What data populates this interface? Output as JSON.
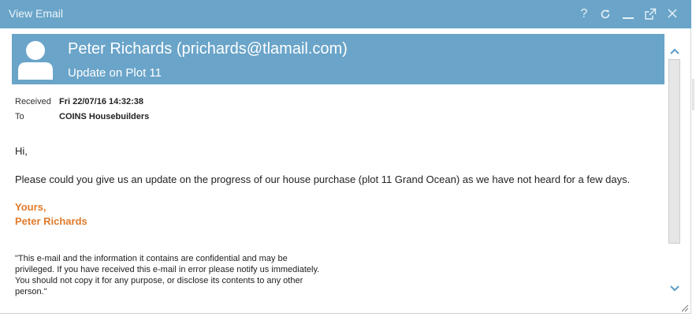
{
  "window": {
    "title": "View Email"
  },
  "title_bar_icons": [
    "help-icon",
    "refresh-icon",
    "minimize-icon",
    "popout-icon",
    "close-icon"
  ],
  "title_bar": {
    "help_glyph": "?"
  },
  "header": {
    "sender": "Peter Richards (prichards@tlamail.com)",
    "subject": "Update on Plot 11"
  },
  "meta": {
    "received_label": "Received",
    "received_value": "Fri 22/07/16 14:32:38",
    "to_label": "To",
    "to_value": "COINS Housebuilders"
  },
  "body": {
    "greeting": "Hi,",
    "message": "Please could you give us an update on the progress of our house purchase (plot 11 Grand Ocean) as we have not heard for a few days.",
    "signoff": "Yours,",
    "signature": "Peter Richards",
    "disclaimer": "\"This e-mail and the information it contains are confidential and may be privileged. If you have received this e-mail in error please notify us immediately. You should not copy it for any purpose, or disclose its contents to any other person.\""
  },
  "colors": {
    "header_blue": "#6aa4c9",
    "signature_orange": "#e07b2c"
  }
}
